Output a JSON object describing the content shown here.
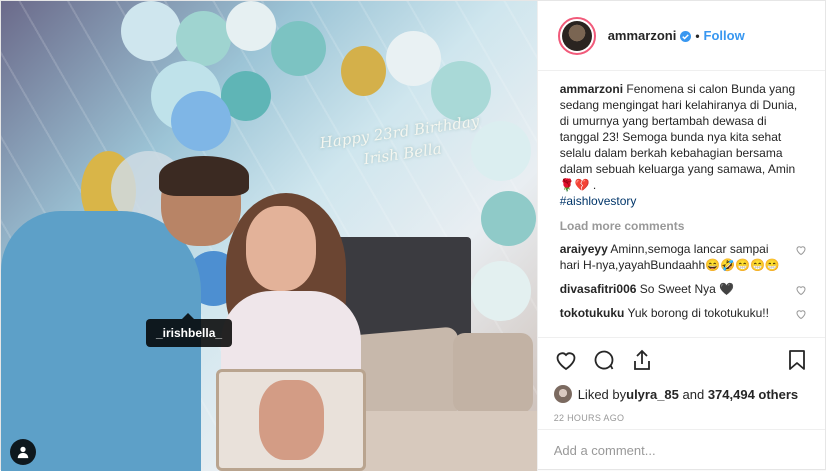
{
  "photo": {
    "banner_text": "Happy 23rd Birthday Irish Bella",
    "tag_label": "_irishbella_"
  },
  "header": {
    "username": "ammarzoni",
    "separator": "•",
    "follow_label": "Follow"
  },
  "caption": {
    "username": "ammarzoni",
    "text": "Fenomena si calon Bunda yang sedang mengingat hari kelahiranya di Dunia, di umurnya yang bertambah dewasa di tanggal 23! Semoga bunda nya kita sehat selalu dalam berkah kebahagian bersama dalam sebuah keluarga yang samawa, Amin🌹💔 .",
    "hashtag": "#aishlovestory"
  },
  "load_more_label": "Load more comments",
  "comments": [
    {
      "username": "araiyeyy",
      "text": "Aminn,semoga lancar sampai hari H-nya,yayahBundaahh😄🤣😁😁😁"
    },
    {
      "username": "divasafitri006",
      "text": "So Sweet Nya 🖤"
    },
    {
      "username": "tokotukuku",
      "text": "Yuk borong di tokotukuku!!"
    }
  ],
  "likes": {
    "prefix": "Liked by ",
    "user": "ulyra_85",
    "middle": " and ",
    "count": "374,494 others"
  },
  "timestamp": "22 HOURS AGO",
  "add_comment": {
    "placeholder": "Add a comment..."
  },
  "icons": {
    "like": "heart-icon",
    "comment": "comment-icon",
    "share": "share-icon",
    "save": "bookmark-icon",
    "user_tag": "person-icon",
    "verified": "verified-badge-icon"
  },
  "colors": {
    "link_blue": "#3897f0",
    "hashtag": "#003569",
    "muted": "#999999",
    "text": "#262626"
  }
}
